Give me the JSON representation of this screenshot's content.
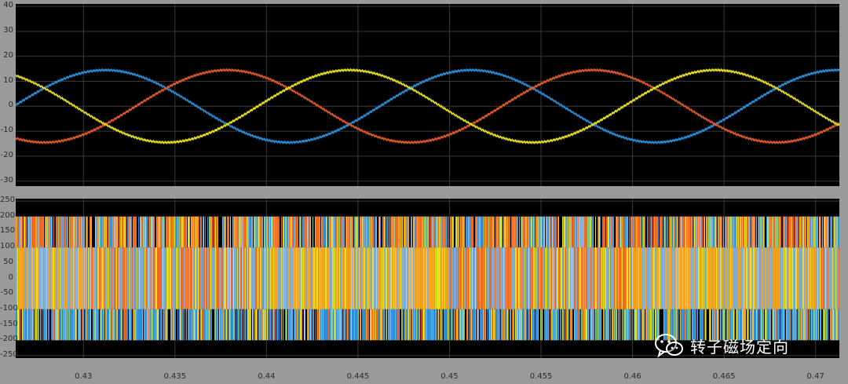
{
  "chart_data": [
    {
      "type": "line",
      "title": "",
      "xlabel": "",
      "ylabel": "",
      "xlim": [
        0.4263,
        0.4713
      ],
      "ylim": [
        -32,
        41
      ],
      "yticks": [
        "40",
        "30",
        "20",
        "10",
        "0",
        "-10",
        "-20",
        "-30"
      ],
      "ytick_values": [
        40,
        30,
        20,
        10,
        0,
        -10,
        -20,
        -30
      ],
      "grid": true,
      "series": [
        {
          "color": "#2a8fd8",
          "amplitude": 14.5,
          "frequency_hz": 50,
          "phase_deg": -111.5
        },
        {
          "color": "#e05a2b",
          "amplitude": 14.5,
          "frequency_hz": 50,
          "phase_deg": 128.5
        },
        {
          "color": "#e6e020",
          "amplitude": 14.5,
          "frequency_hz": 50,
          "phase_deg": 8.5
        }
      ]
    },
    {
      "type": "line",
      "title": "",
      "xlabel": "",
      "ylabel": "",
      "xlim": [
        0.4263,
        0.4713
      ],
      "ylim": [
        -258,
        258
      ],
      "yticks": [
        "250",
        "200",
        "150",
        "100",
        "50",
        "0",
        "-50",
        "-100",
        "-150",
        "-200",
        "-250"
      ],
      "ytick_values": [
        250,
        200,
        150,
        100,
        50,
        0,
        -50,
        -100,
        -150,
        -200,
        -250
      ],
      "grid": true,
      "levels": [
        -200,
        -100,
        0,
        100,
        200
      ],
      "series": [
        {
          "color": "#2a8fd8"
        },
        {
          "color": "#f06a20"
        },
        {
          "color": "#e6e020"
        },
        {
          "color": "#f5a623"
        },
        {
          "color": "#7faad4"
        },
        {
          "color": "#8ed081"
        }
      ]
    }
  ],
  "x_ticks": [
    "0.43",
    "0.435",
    "0.44",
    "0.445",
    "0.45",
    "0.455",
    "0.46",
    "0.465",
    "0.47"
  ],
  "x_tick_values": [
    0.43,
    0.435,
    0.44,
    0.445,
    0.45,
    0.455,
    0.46,
    0.465,
    0.47
  ],
  "watermark": {
    "text": "转子磁场定向",
    "icon": "wechat-icon"
  }
}
